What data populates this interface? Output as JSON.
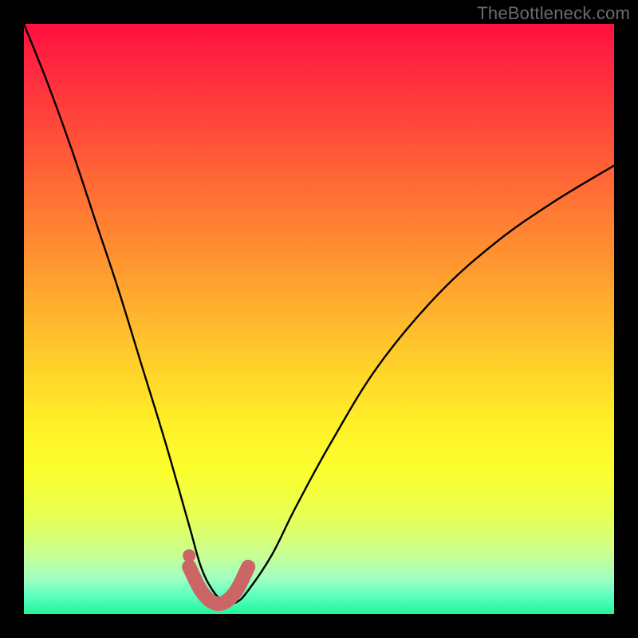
{
  "watermark": "TheBottleneck.com",
  "chart_data": {
    "type": "line",
    "title": "",
    "xlabel": "",
    "ylabel": "",
    "xlim": [
      0,
      100
    ],
    "ylim": [
      0,
      100
    ],
    "series": [
      {
        "name": "bottleneck-curve",
        "x": [
          0,
          4,
          8,
          12,
          16,
          20,
          24,
          28,
          30,
          32,
          34,
          36,
          38,
          42,
          46,
          52,
          60,
          70,
          80,
          90,
          100
        ],
        "y": [
          100,
          90,
          79,
          67,
          55,
          42,
          29,
          15,
          8,
          4,
          2,
          2,
          4,
          10,
          18,
          29,
          42,
          54,
          63,
          70,
          76
        ]
      }
    ],
    "highlight": {
      "name": "bottom-band",
      "x": [
        28,
        30,
        32,
        34,
        36,
        38
      ],
      "y": [
        8,
        4,
        2,
        2,
        4,
        8
      ],
      "color": "#cc6666"
    },
    "background_gradient": {
      "top": "#ff1a3a",
      "mid": "#ffd92b",
      "bottom": "#2af59a"
    }
  }
}
